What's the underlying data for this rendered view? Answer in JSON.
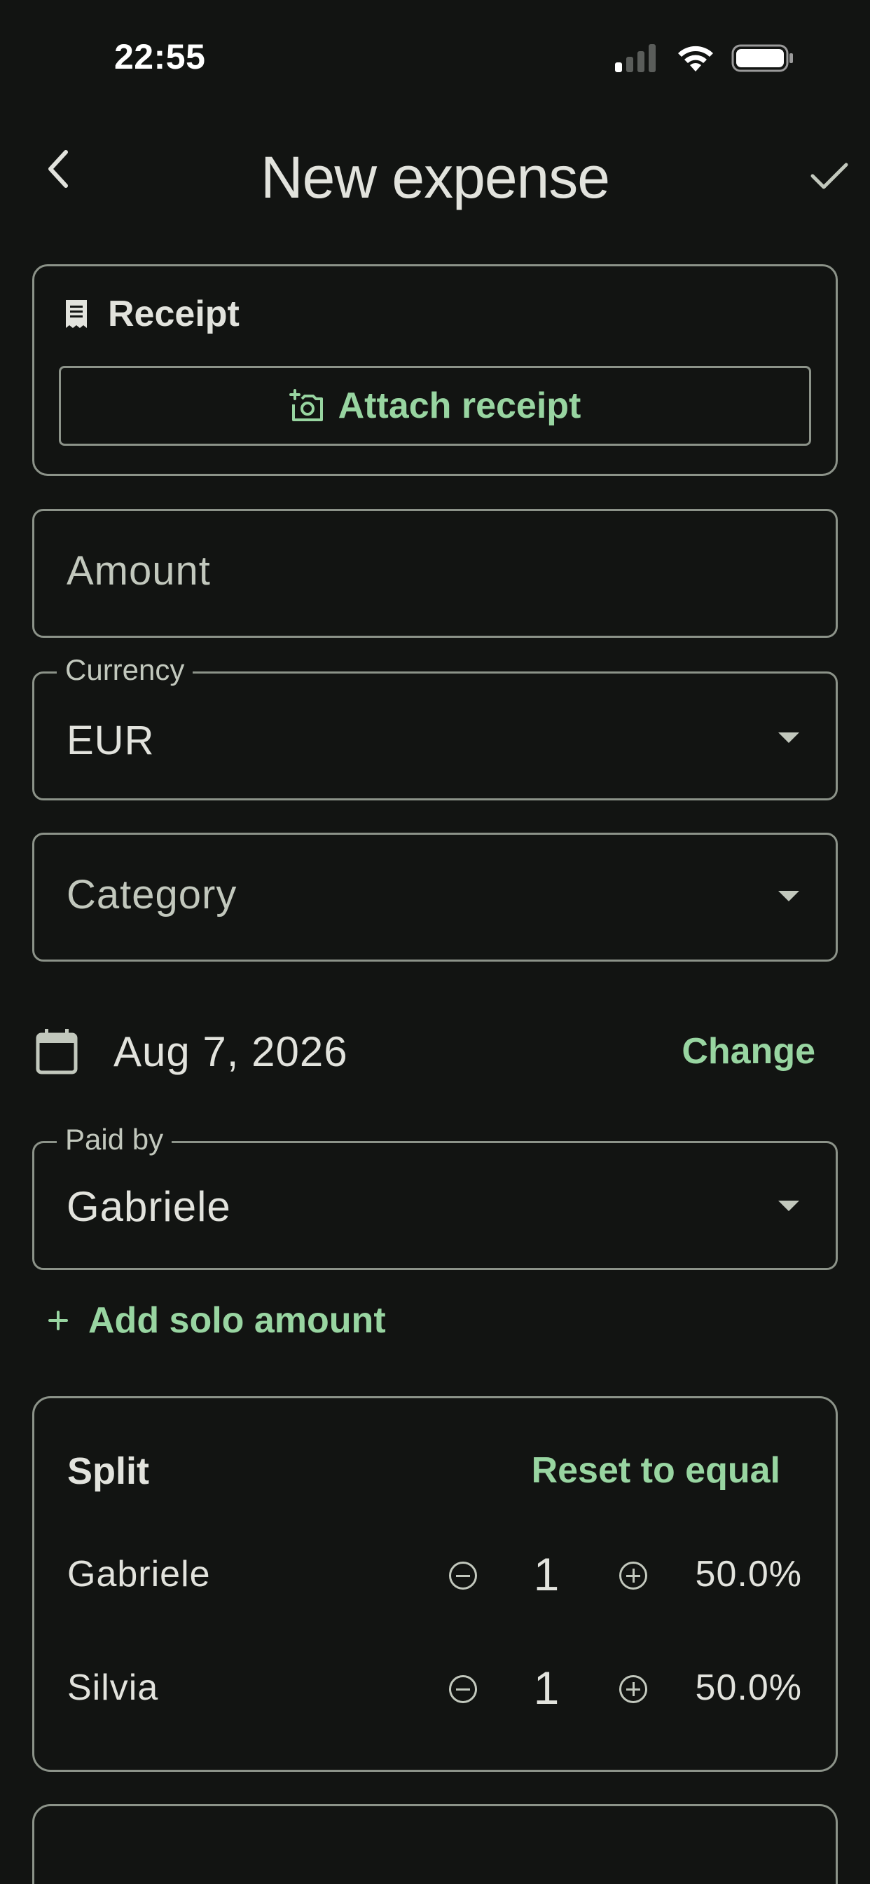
{
  "status_bar": {
    "time": "22:55"
  },
  "header": {
    "title": "New expense"
  },
  "receipt": {
    "title": "Receipt",
    "attach_label": "Attach receipt"
  },
  "amount": {
    "placeholder": "Amount"
  },
  "currency": {
    "label": "Currency",
    "value": "EUR"
  },
  "category": {
    "placeholder": "Category"
  },
  "date": {
    "value": "Aug 7, 2026",
    "change_label": "Change"
  },
  "paid_by": {
    "label": "Paid by",
    "value": "Gabriele"
  },
  "solo": {
    "add_label": "Add solo amount"
  },
  "split": {
    "title": "Split",
    "reset_label": "Reset to equal",
    "rows": [
      {
        "name": "Gabriele",
        "count": "1",
        "percent": "50.0%"
      },
      {
        "name": "Silvia",
        "count": "1",
        "percent": "50.0%"
      }
    ]
  },
  "colors": {
    "background": "#121412",
    "accent": "#98d5a1",
    "outline": "#8c9389",
    "text": "#e2e3dd"
  }
}
